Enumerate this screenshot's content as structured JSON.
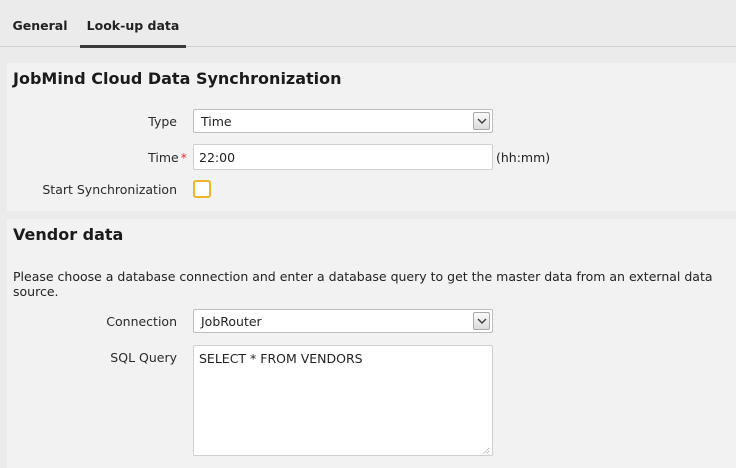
{
  "tabs": [
    {
      "label": "General",
      "active": false
    },
    {
      "label": "Look-up data",
      "active": true
    }
  ],
  "sync": {
    "title": "JobMind Cloud Data Synchronization",
    "type_label": "Type",
    "type_value": "Time",
    "time_label": "Time",
    "required_mark": "*",
    "time_value": "22:00",
    "time_hint": "(hh:mm)",
    "start_label": "Start Synchronization",
    "start_checked": false
  },
  "vendor": {
    "title": "Vendor data",
    "description": "Please choose a database connection and enter a database query to get the master data from an external data source.",
    "connection_label": "Connection",
    "connection_value": "JobRouter",
    "sql_label": "SQL Query",
    "sql_value": "SELECT * FROM VENDORS"
  },
  "colors": {
    "accent_checkbox": "#f0b429",
    "required": "#dd3333",
    "background": "#ebebeb",
    "panel": "#f2f2f2"
  }
}
